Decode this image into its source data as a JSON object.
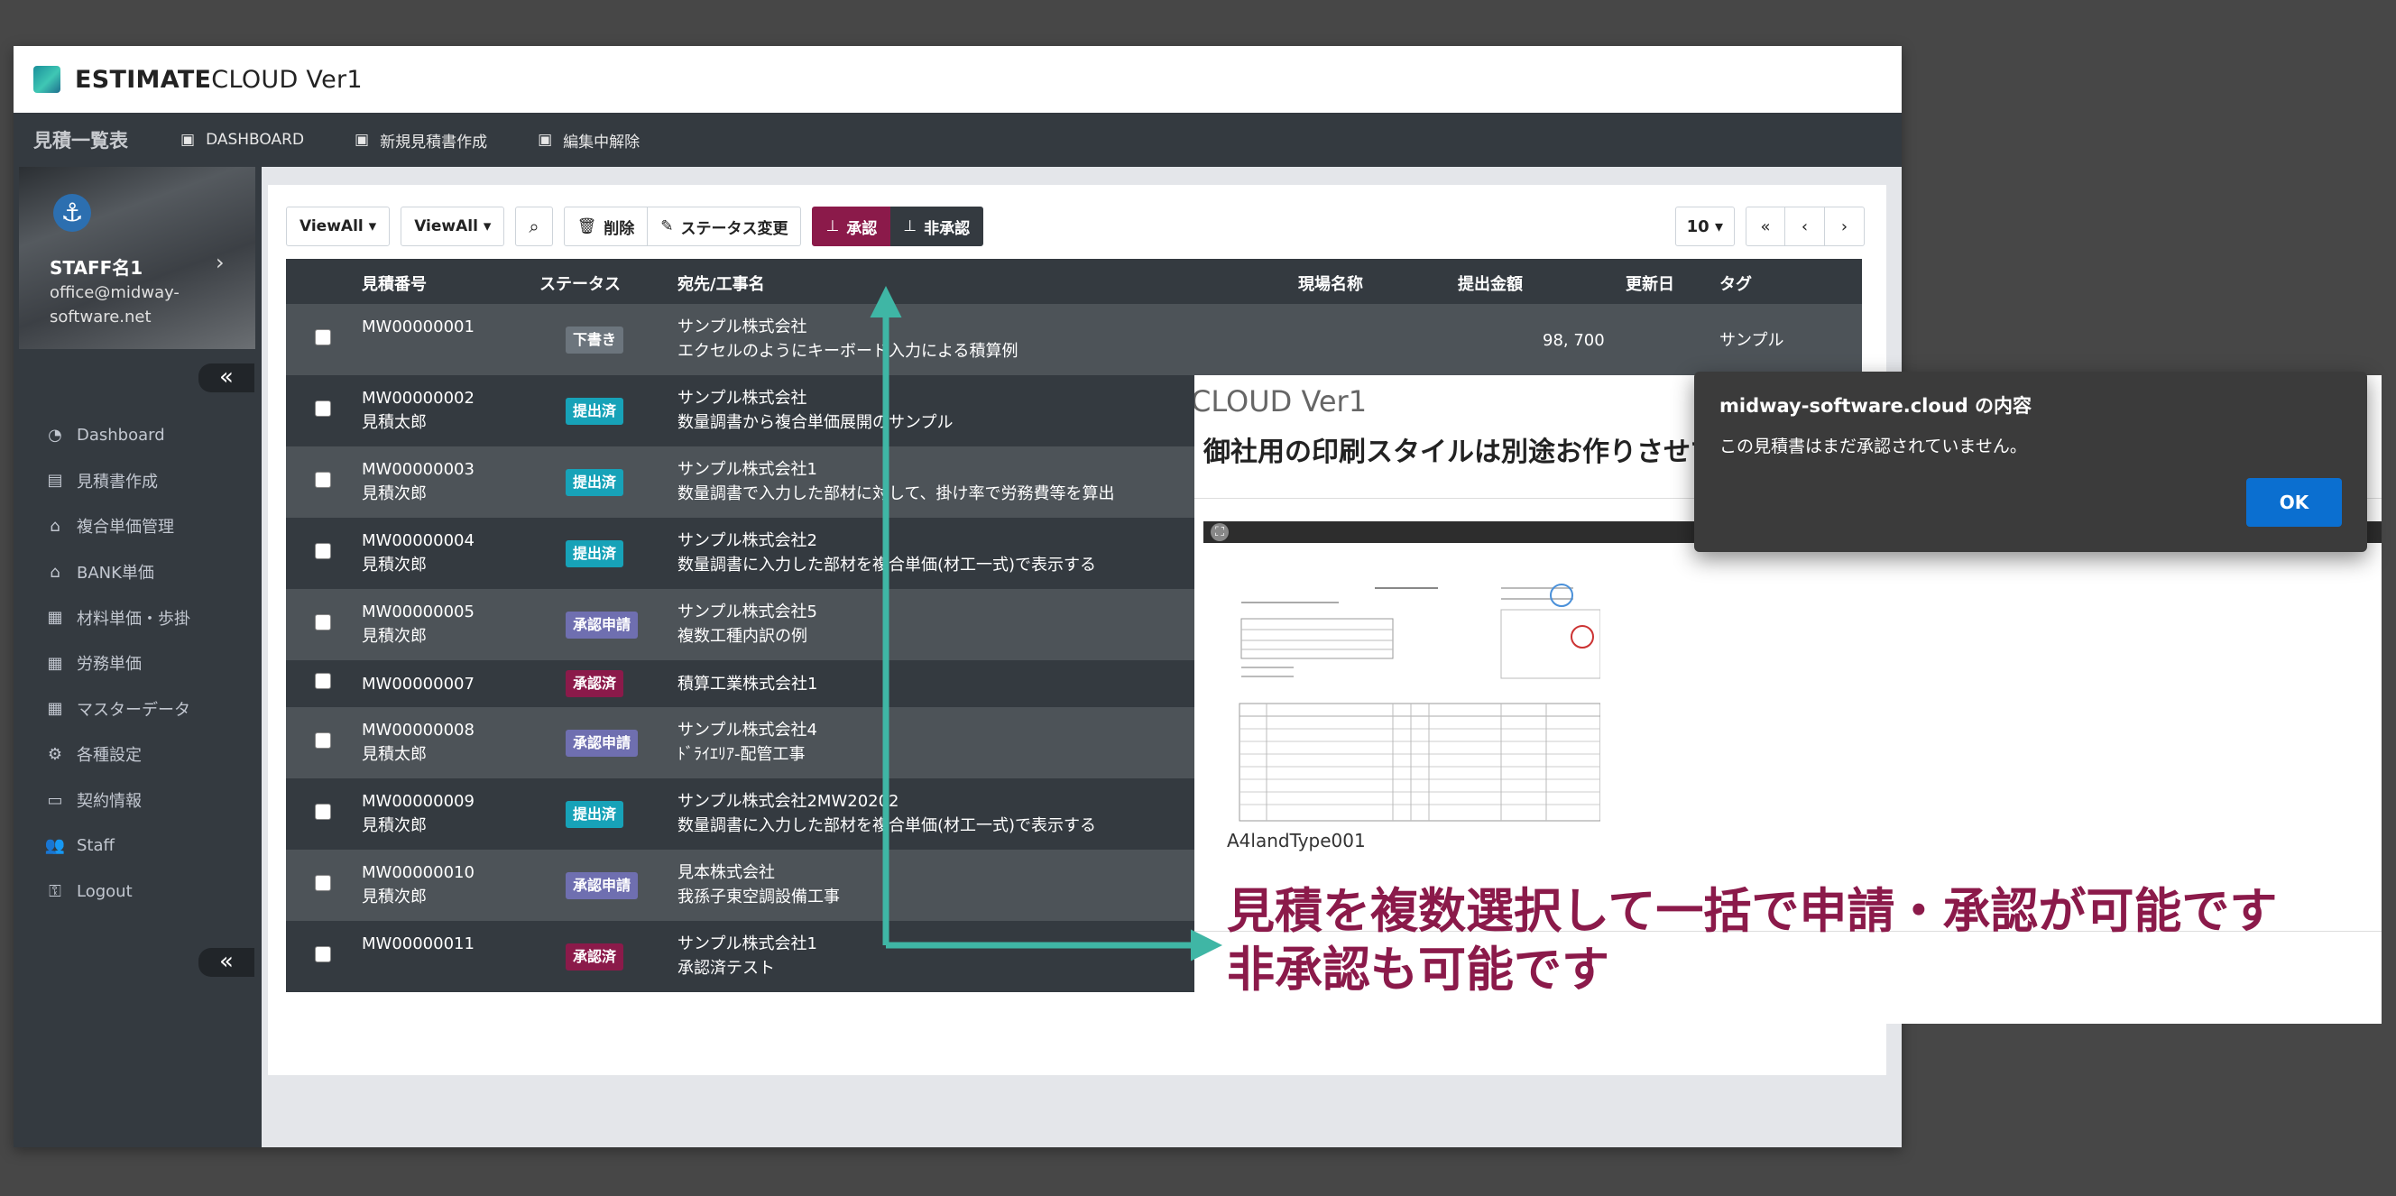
{
  "window": {
    "title_bold": "ESTIMATE",
    "title_rest": "CLOUD Ver1",
    "accent_color": "#3fc7b4"
  },
  "topnav": {
    "brand": "見積一覧表",
    "items": [
      {
        "icon": "film-icon",
        "label": "DASHBOARD"
      },
      {
        "icon": "film-icon",
        "label": "新規見積書作成"
      },
      {
        "icon": "film-icon",
        "label": "編集中解除"
      }
    ]
  },
  "user": {
    "name": "STAFF名1",
    "email": "office@midway-software.net"
  },
  "sidebar": {
    "collapse_glyph": "«",
    "items": [
      {
        "icon": "pie-chart-icon",
        "label": "Dashboard"
      },
      {
        "icon": "document-icon",
        "label": "見積書作成"
      },
      {
        "icon": "bank-icon",
        "label": "複合単価管理"
      },
      {
        "icon": "bank-icon",
        "label": "BANK単価"
      },
      {
        "icon": "grid-icon",
        "label": "材料単価・歩掛"
      },
      {
        "icon": "grid-icon",
        "label": "労務単価"
      },
      {
        "icon": "grid-icon",
        "label": "マスターデータ"
      },
      {
        "icon": "gears-icon",
        "label": "各種設定"
      },
      {
        "icon": "credit-card-icon",
        "label": "契約情報"
      },
      {
        "icon": "users-icon",
        "label": "Staff"
      },
      {
        "icon": "key-icon",
        "label": "Logout"
      }
    ]
  },
  "toolbar": {
    "view_all_1": "ViewAll",
    "view_all_2": "ViewAll",
    "delete": "削除",
    "status_change": "ステータス変更",
    "approve": "承認",
    "reject": "非承認"
  },
  "pager": {
    "per_page": "10",
    "first": "«",
    "prev": "‹",
    "next": "›"
  },
  "table": {
    "headers": {
      "number": "見積番号",
      "status": "ステータス",
      "client": "宛先/工事名",
      "site": "現場名称",
      "amount": "提出金額",
      "updated": "更新日",
      "tag": "タグ"
    },
    "rows": [
      {
        "number": "MW00000001",
        "person": "",
        "status": "下書き",
        "status_color": "#6c757d",
        "client": "サンプル株式会社",
        "project": "エクセルのようにキーボード入力による積算例",
        "amount": "98, 700",
        "tag": "サンプル"
      },
      {
        "number": "MW00000002",
        "person": "見積太郎",
        "status": "提出済",
        "status_color": "#17a2b8",
        "client": "サンプル株式会社",
        "project": "数量調書から複合単価展開のサンプル",
        "amount": "",
        "tag": ""
      },
      {
        "number": "MW00000003",
        "person": "見積次郎",
        "status": "提出済",
        "status_color": "#17a2b8",
        "client": "サンプル株式会社1",
        "project": "数量調書で入力した部材に対して、掛け率で労務費等を算出",
        "amount": "",
        "tag": ""
      },
      {
        "number": "MW00000004",
        "person": "見積次郎",
        "status": "提出済",
        "status_color": "#17a2b8",
        "client": "サンプル株式会社2",
        "project": "数量調書に入力した部材を複合単価(材工一式)で表示する",
        "amount": "",
        "tag": ""
      },
      {
        "number": "MW00000005",
        "person": "見積次郎",
        "status": "承認申請",
        "status_color": "#6f6fb0",
        "client": "サンプル株式会社5",
        "project": "複数工種内訳の例",
        "amount": "",
        "tag": ""
      },
      {
        "number": "MW00000007",
        "person": "",
        "status": "承認済",
        "status_color": "#8b1a4a",
        "client": "積算工業株式会社1",
        "project": "",
        "amount": "",
        "tag": ""
      },
      {
        "number": "MW00000008",
        "person": "見積太郎",
        "status": "承認申請",
        "status_color": "#6f6fb0",
        "client": "サンプル株式会社4",
        "project": "ﾄﾞﾗｲｴﾘｱ-配管工事",
        "amount": "",
        "tag": ""
      },
      {
        "number": "MW00000009",
        "person": "見積次郎",
        "status": "提出済",
        "status_color": "#17a2b8",
        "client": "サンプル株式会社2MW20202",
        "project": "数量調書に入力した部材を複合単価(材工一式)で表示する",
        "amount": "",
        "tag": ""
      },
      {
        "number": "MW00000010",
        "person": "見積次郎",
        "status": "承認申請",
        "status_color": "#6f6fb0",
        "client": "見本株式会社",
        "project": "我孫子東空調設備工事",
        "amount": "",
        "tag": ""
      },
      {
        "number": "MW00000011",
        "person": "",
        "status": "承認済",
        "status_color": "#8b1a4a",
        "client": "サンプル株式会社1",
        "project": "承認済テスト",
        "amount": "",
        "tag": ""
      }
    ]
  },
  "overlay": {
    "ghost_title": "CLOUD Ver1",
    "heading": "御社用の印刷スタイルは別途お作りさせて",
    "caption": "A4landType001"
  },
  "promo": {
    "line1": "見積を複数選択して一括で申請・承認が可能です",
    "line2": "非承認も可能です",
    "color": "#8b1a4a"
  },
  "dialog": {
    "title": "midway-software.cloud の内容",
    "message": "この見積書はまだ承認されていません。",
    "ok": "OK"
  }
}
